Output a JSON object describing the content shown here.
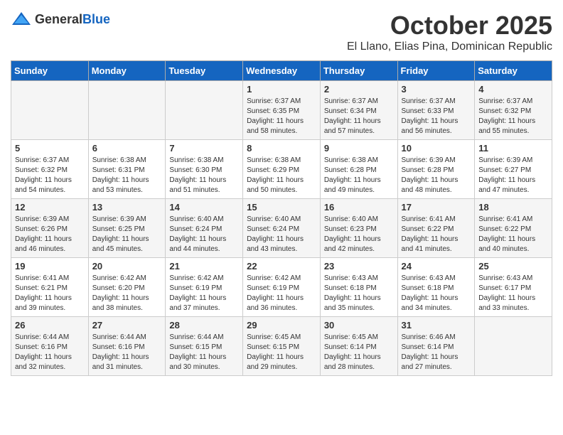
{
  "logo": {
    "text_general": "General",
    "text_blue": "Blue"
  },
  "header": {
    "month": "October 2025",
    "location": "El Llano, Elias Pina, Dominican Republic"
  },
  "weekdays": [
    "Sunday",
    "Monday",
    "Tuesday",
    "Wednesday",
    "Thursday",
    "Friday",
    "Saturday"
  ],
  "weeks": [
    [
      {
        "day": "",
        "info": ""
      },
      {
        "day": "",
        "info": ""
      },
      {
        "day": "",
        "info": ""
      },
      {
        "day": "1",
        "info": "Sunrise: 6:37 AM\nSunset: 6:35 PM\nDaylight: 11 hours\nand 58 minutes."
      },
      {
        "day": "2",
        "info": "Sunrise: 6:37 AM\nSunset: 6:34 PM\nDaylight: 11 hours\nand 57 minutes."
      },
      {
        "day": "3",
        "info": "Sunrise: 6:37 AM\nSunset: 6:33 PM\nDaylight: 11 hours\nand 56 minutes."
      },
      {
        "day": "4",
        "info": "Sunrise: 6:37 AM\nSunset: 6:32 PM\nDaylight: 11 hours\nand 55 minutes."
      }
    ],
    [
      {
        "day": "5",
        "info": "Sunrise: 6:37 AM\nSunset: 6:32 PM\nDaylight: 11 hours\nand 54 minutes."
      },
      {
        "day": "6",
        "info": "Sunrise: 6:38 AM\nSunset: 6:31 PM\nDaylight: 11 hours\nand 53 minutes."
      },
      {
        "day": "7",
        "info": "Sunrise: 6:38 AM\nSunset: 6:30 PM\nDaylight: 11 hours\nand 51 minutes."
      },
      {
        "day": "8",
        "info": "Sunrise: 6:38 AM\nSunset: 6:29 PM\nDaylight: 11 hours\nand 50 minutes."
      },
      {
        "day": "9",
        "info": "Sunrise: 6:38 AM\nSunset: 6:28 PM\nDaylight: 11 hours\nand 49 minutes."
      },
      {
        "day": "10",
        "info": "Sunrise: 6:39 AM\nSunset: 6:28 PM\nDaylight: 11 hours\nand 48 minutes."
      },
      {
        "day": "11",
        "info": "Sunrise: 6:39 AM\nSunset: 6:27 PM\nDaylight: 11 hours\nand 47 minutes."
      }
    ],
    [
      {
        "day": "12",
        "info": "Sunrise: 6:39 AM\nSunset: 6:26 PM\nDaylight: 11 hours\nand 46 minutes."
      },
      {
        "day": "13",
        "info": "Sunrise: 6:39 AM\nSunset: 6:25 PM\nDaylight: 11 hours\nand 45 minutes."
      },
      {
        "day": "14",
        "info": "Sunrise: 6:40 AM\nSunset: 6:24 PM\nDaylight: 11 hours\nand 44 minutes."
      },
      {
        "day": "15",
        "info": "Sunrise: 6:40 AM\nSunset: 6:24 PM\nDaylight: 11 hours\nand 43 minutes."
      },
      {
        "day": "16",
        "info": "Sunrise: 6:40 AM\nSunset: 6:23 PM\nDaylight: 11 hours\nand 42 minutes."
      },
      {
        "day": "17",
        "info": "Sunrise: 6:41 AM\nSunset: 6:22 PM\nDaylight: 11 hours\nand 41 minutes."
      },
      {
        "day": "18",
        "info": "Sunrise: 6:41 AM\nSunset: 6:22 PM\nDaylight: 11 hours\nand 40 minutes."
      }
    ],
    [
      {
        "day": "19",
        "info": "Sunrise: 6:41 AM\nSunset: 6:21 PM\nDaylight: 11 hours\nand 39 minutes."
      },
      {
        "day": "20",
        "info": "Sunrise: 6:42 AM\nSunset: 6:20 PM\nDaylight: 11 hours\nand 38 minutes."
      },
      {
        "day": "21",
        "info": "Sunrise: 6:42 AM\nSunset: 6:19 PM\nDaylight: 11 hours\nand 37 minutes."
      },
      {
        "day": "22",
        "info": "Sunrise: 6:42 AM\nSunset: 6:19 PM\nDaylight: 11 hours\nand 36 minutes."
      },
      {
        "day": "23",
        "info": "Sunrise: 6:43 AM\nSunset: 6:18 PM\nDaylight: 11 hours\nand 35 minutes."
      },
      {
        "day": "24",
        "info": "Sunrise: 6:43 AM\nSunset: 6:18 PM\nDaylight: 11 hours\nand 34 minutes."
      },
      {
        "day": "25",
        "info": "Sunrise: 6:43 AM\nSunset: 6:17 PM\nDaylight: 11 hours\nand 33 minutes."
      }
    ],
    [
      {
        "day": "26",
        "info": "Sunrise: 6:44 AM\nSunset: 6:16 PM\nDaylight: 11 hours\nand 32 minutes."
      },
      {
        "day": "27",
        "info": "Sunrise: 6:44 AM\nSunset: 6:16 PM\nDaylight: 11 hours\nand 31 minutes."
      },
      {
        "day": "28",
        "info": "Sunrise: 6:44 AM\nSunset: 6:15 PM\nDaylight: 11 hours\nand 30 minutes."
      },
      {
        "day": "29",
        "info": "Sunrise: 6:45 AM\nSunset: 6:15 PM\nDaylight: 11 hours\nand 29 minutes."
      },
      {
        "day": "30",
        "info": "Sunrise: 6:45 AM\nSunset: 6:14 PM\nDaylight: 11 hours\nand 28 minutes."
      },
      {
        "day": "31",
        "info": "Sunrise: 6:46 AM\nSunset: 6:14 PM\nDaylight: 11 hours\nand 27 minutes."
      },
      {
        "day": "",
        "info": ""
      }
    ]
  ]
}
